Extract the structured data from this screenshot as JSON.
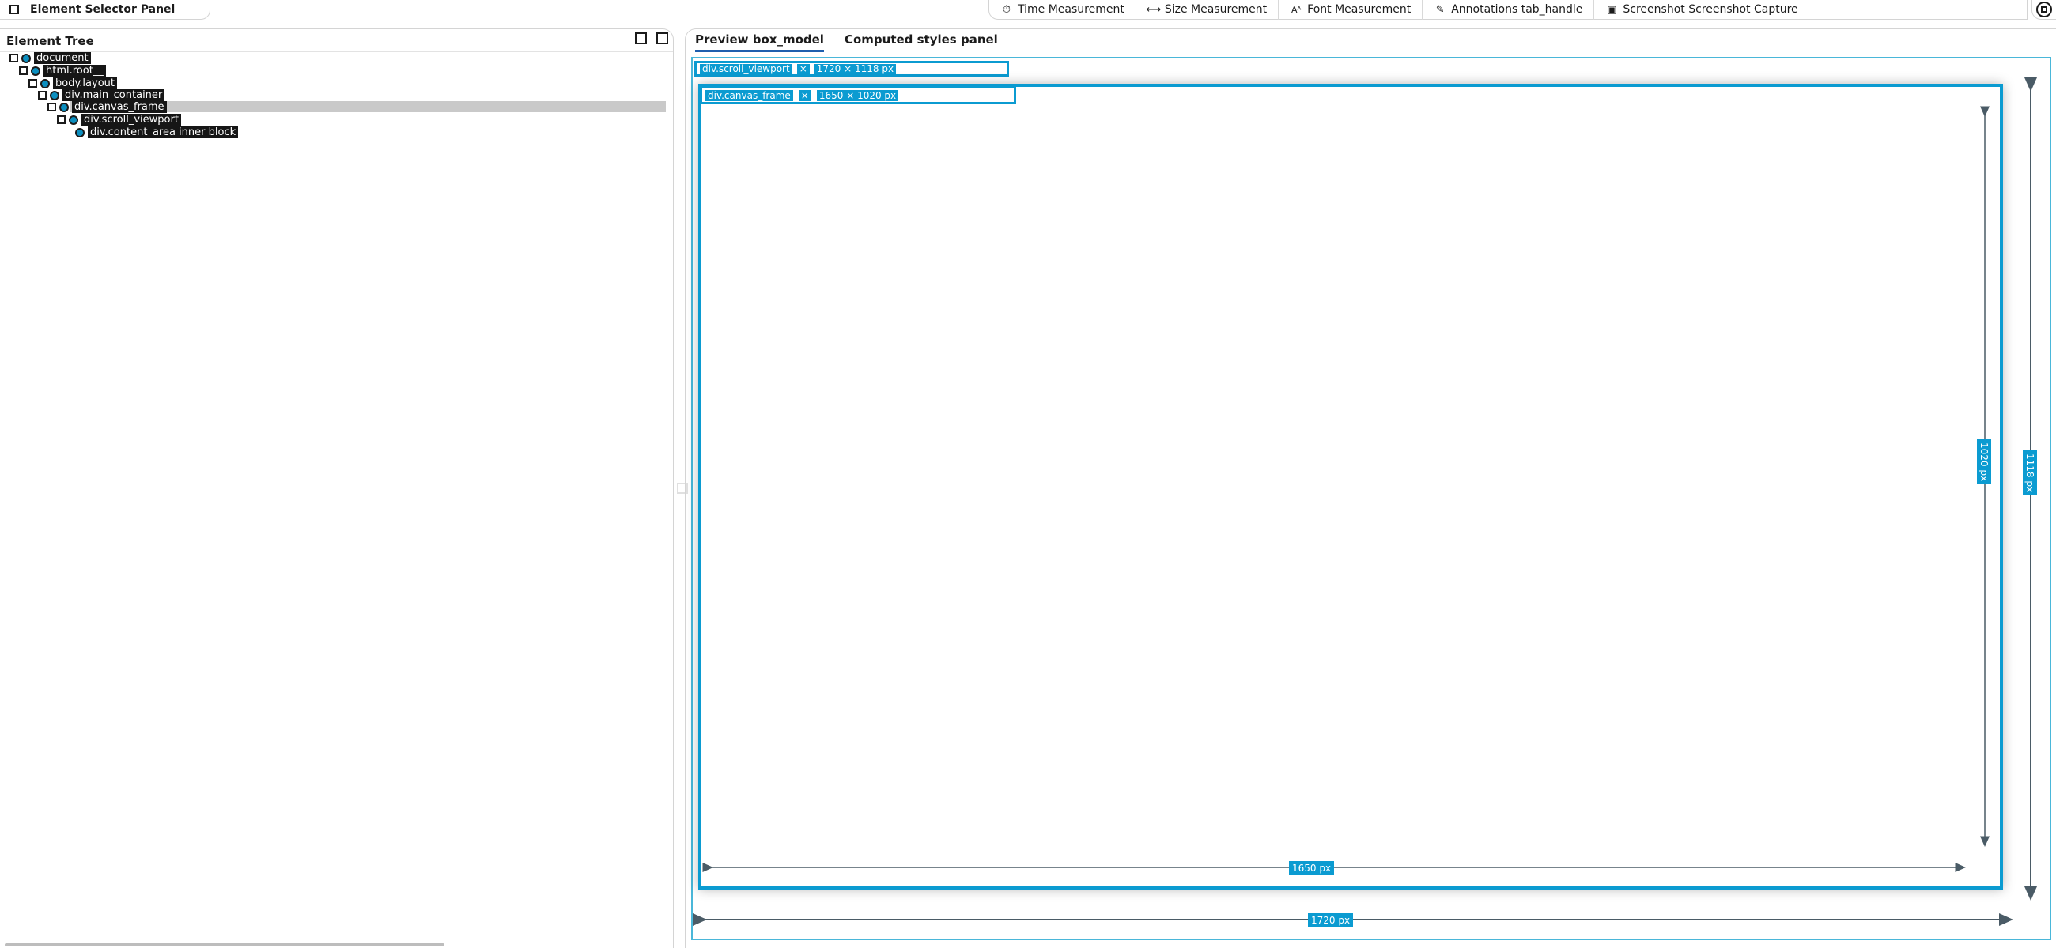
{
  "topbar": {
    "left_label": "Element Selector Panel",
    "items": [
      {
        "icon": "stopwatch-icon",
        "label": "Time Measurement"
      },
      {
        "icon": "ruler-icon",
        "label": "Size Measurement"
      },
      {
        "icon": "text-size-icon",
        "label": "Font Measurement"
      },
      {
        "icon": "pen-icon",
        "label": "Annotations tab_handle"
      },
      {
        "icon": "image-icon",
        "label": "Screenshot Screenshot Capture"
      }
    ]
  },
  "left": {
    "header": "Element Tree",
    "tree": [
      {
        "label": "document",
        "level": 0
      },
      {
        "label": "html.root__",
        "level": 1
      },
      {
        "label": "body.layout",
        "level": 2
      },
      {
        "label": "div.main_container",
        "level": 3
      },
      {
        "label": "div.canvas_frame",
        "level": 4,
        "selected": true
      },
      {
        "label": "div.scroll_viewport",
        "level": 5
      },
      {
        "label": "div.content_area inner block",
        "level": 6
      }
    ]
  },
  "right": {
    "tabs": [
      "Preview box_model",
      "Computed styles panel"
    ],
    "outer_label": {
      "left": "div.scroll_viewport",
      "mid": "×",
      "right": "1720 × 1118 px"
    },
    "inner_label": {
      "left": "div.canvas_frame",
      "mid": "×",
      "right": "1650 × 1020 px"
    },
    "inner_width": "1650 px",
    "inner_height": "1020 px",
    "outer_width": "1720 px",
    "outer_height": "1118 px"
  },
  "colors": {
    "accent": "#0b9bd1",
    "tab_underline": "#1f5fae",
    "selection": "#c9c9c9"
  }
}
